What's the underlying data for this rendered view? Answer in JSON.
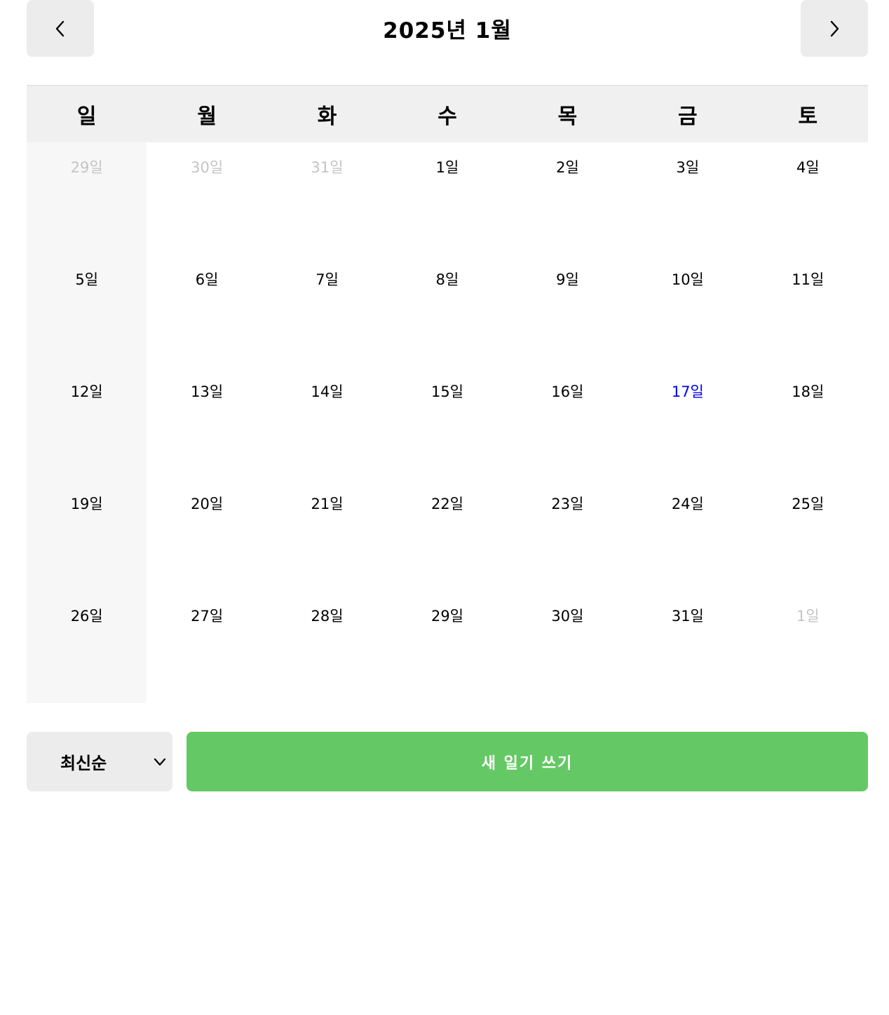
{
  "header": {
    "title": "2025년 1월",
    "prev_icon": "chevron-left-icon",
    "next_icon": "chevron-right-icon"
  },
  "calendar": {
    "weekdays": [
      "일",
      "월",
      "화",
      "수",
      "목",
      "금",
      "토"
    ],
    "weeks": [
      [
        {
          "label": "29일",
          "state": "other"
        },
        {
          "label": "30일",
          "state": "other"
        },
        {
          "label": "31일",
          "state": "other"
        },
        {
          "label": "1일",
          "state": "current"
        },
        {
          "label": "2일",
          "state": "current"
        },
        {
          "label": "3일",
          "state": "current"
        },
        {
          "label": "4일",
          "state": "current"
        }
      ],
      [
        {
          "label": "5일",
          "state": "current"
        },
        {
          "label": "6일",
          "state": "current"
        },
        {
          "label": "7일",
          "state": "current"
        },
        {
          "label": "8일",
          "state": "current"
        },
        {
          "label": "9일",
          "state": "current"
        },
        {
          "label": "10일",
          "state": "current"
        },
        {
          "label": "11일",
          "state": "current"
        }
      ],
      [
        {
          "label": "12일",
          "state": "current"
        },
        {
          "label": "13일",
          "state": "current"
        },
        {
          "label": "14일",
          "state": "current"
        },
        {
          "label": "15일",
          "state": "current"
        },
        {
          "label": "16일",
          "state": "current"
        },
        {
          "label": "17일",
          "state": "today"
        },
        {
          "label": "18일",
          "state": "current"
        }
      ],
      [
        {
          "label": "19일",
          "state": "current"
        },
        {
          "label": "20일",
          "state": "current"
        },
        {
          "label": "21일",
          "state": "current"
        },
        {
          "label": "22일",
          "state": "current"
        },
        {
          "label": "23일",
          "state": "current"
        },
        {
          "label": "24일",
          "state": "current"
        },
        {
          "label": "25일",
          "state": "current"
        }
      ],
      [
        {
          "label": "26일",
          "state": "current"
        },
        {
          "label": "27일",
          "state": "current"
        },
        {
          "label": "28일",
          "state": "current"
        },
        {
          "label": "29일",
          "state": "current"
        },
        {
          "label": "30일",
          "state": "current"
        },
        {
          "label": "31일",
          "state": "current"
        },
        {
          "label": "1일",
          "state": "other"
        }
      ]
    ]
  },
  "controls": {
    "sort_value": "최신순",
    "sort_icon": "chevron-down-icon",
    "new_entry_label": "새 일기 쓰기"
  },
  "colors": {
    "nav_button_bg": "#ececec",
    "weekday_header_bg": "#f0f0f0",
    "sunday_column_bg": "#f7f7f7",
    "other_month_text": "#c4c4c4",
    "today_text": "#0000ee",
    "primary_button_bg": "#64c964",
    "primary_button_text": "#ffffff"
  }
}
